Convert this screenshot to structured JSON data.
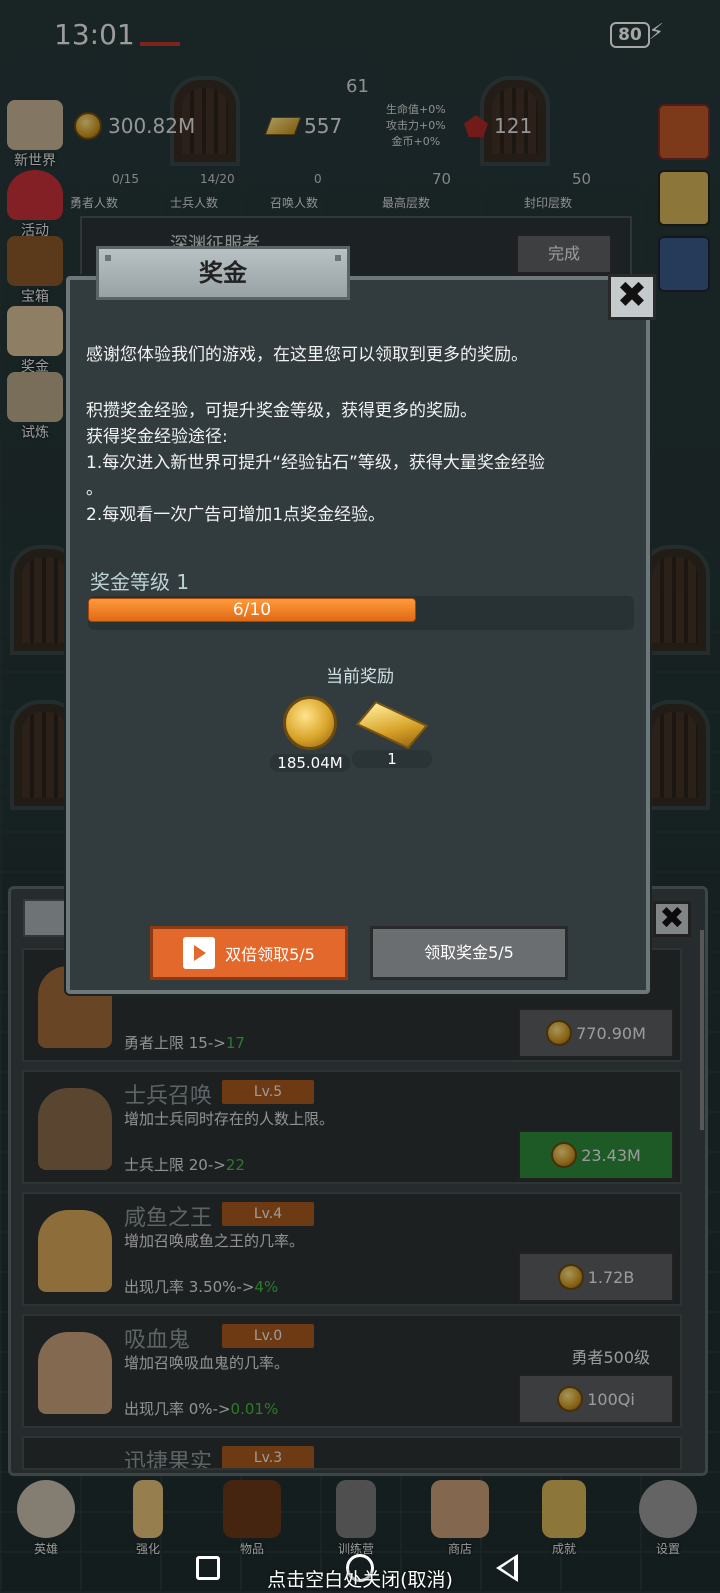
{
  "status_bar": {
    "time": "13:01",
    "battery": "80"
  },
  "top": {
    "floor": "61",
    "gold": "300.82M",
    "gold_bars": "557",
    "gems": "121",
    "buffs": [
      "生命值+0%",
      "攻击力+0%",
      "金币+0%"
    ],
    "counts": [
      {
        "value": "0/15",
        "label": "勇者人数"
      },
      {
        "value": "14/20",
        "label": "士兵人数"
      },
      {
        "value": "0",
        "label": "召唤人数"
      },
      {
        "value": "70",
        "label": "最高层数"
      },
      {
        "value": "50",
        "label": "封印层数"
      }
    ]
  },
  "side_menu": [
    "新世界",
    "活动",
    "宝箱",
    "奖金",
    "试炼"
  ],
  "quest": {
    "title": "深渊征服者",
    "button": "完成"
  },
  "modal": {
    "title": "奖金",
    "close": "✖",
    "para1": "感谢您体验我们的游戏，在这里您可以领取到更多的奖励。",
    "para2": "积攒奖金经验，可提升奖金等级，获得更多的奖励。",
    "para3": "获得奖金经验途径:",
    "para4": "1.每次进入新世界可提升“经验钻石”等级，获得大量奖金经验",
    "para5": "。",
    "para6": "2.每观看一次广告可增加1点奖金经验。",
    "level_label": "奖金等级 1",
    "progress_text": "6/10",
    "progress_fraction": 0.6,
    "rewards_title": "当前奖励",
    "rewards": [
      {
        "icon": "gold-coin-icon",
        "amount": "185.04M"
      },
      {
        "icon": "gold-bar-icon",
        "amount": "1"
      }
    ],
    "double_button": "双倍领取5/5",
    "claim_button": "领取奖金5/5"
  },
  "list": {
    "cards": [
      {
        "name": "",
        "lv": "",
        "desc": "",
        "change_prefix": "勇者上限 15->",
        "change_up": "17",
        "price": "770.90M",
        "green": false
      },
      {
        "name": "士兵召唤",
        "lv": "Lv.5",
        "desc": "增加士兵同时存在的人数上限。",
        "change_prefix": "士兵上限 20->",
        "change_up": "22",
        "price": "23.43M",
        "green": true
      },
      {
        "name": "咸鱼之王",
        "lv": "Lv.4",
        "desc": "增加召唤咸鱼之王的几率。",
        "change_prefix": "出现几率 3.50%->",
        "change_up": "4%",
        "price": "1.72B",
        "green": false
      },
      {
        "name": "吸血鬼",
        "lv": "Lv.0",
        "desc": "增加召唤吸血鬼的几率。",
        "change_prefix": "出现几率 0%->",
        "change_up": "0.01%",
        "price": "100Qi",
        "green": false,
        "requirement": "勇者500级"
      },
      {
        "name": "迅捷果实",
        "lv": "Lv.3"
      }
    ]
  },
  "nav": [
    "英雄",
    "强化",
    "物品",
    "训练营",
    "商店",
    "成就",
    "设置"
  ],
  "close_hint": "点击空白处关闭(取消)"
}
